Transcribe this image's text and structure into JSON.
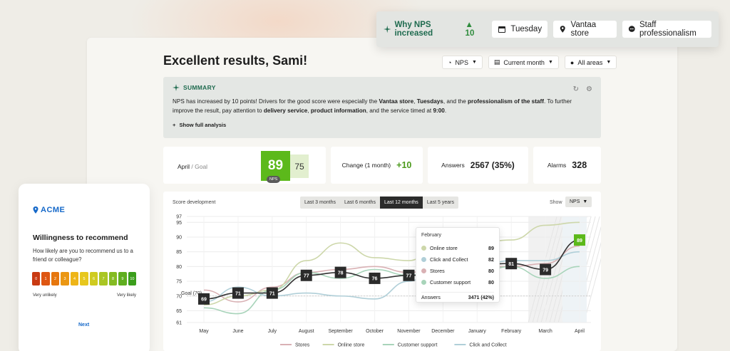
{
  "insight_bar": {
    "insight_label": "Why NPS increased",
    "insight_delta": "▲ 10",
    "chips": [
      "Tuesday",
      "Vantaa store",
      "Staff professionalism"
    ]
  },
  "header": {
    "title": "Excellent results, Sami!",
    "filters": {
      "metric": "NPS",
      "period": "Current month",
      "area": "All areas"
    }
  },
  "summary": {
    "heading": "SUMMARY",
    "text_html": "NPS has increased by 10 points! Drivers for the good score were especially the <b>Vantaa store</b>, <b>Tuesdays</b>, and the <b>professionalism of the staff</b>. To further improve the result, pay attention to <b>delivery service</b>, <b>product information</b>, and the service timed at <b>9:00</b>.",
    "show_more": "Show full analysis"
  },
  "cards": {
    "month_label": "April",
    "goal_label": "/ Goal",
    "score": "89",
    "goal": "75",
    "score_tag": "NPS",
    "change_label": "Change (1 month)",
    "change_value": "+10",
    "answers_label": "Answers",
    "answers_value": "2567 (35%)",
    "alarms_label": "Alarms",
    "alarms_value": "328"
  },
  "chart_panel": {
    "title": "Score development",
    "ranges": [
      "Last 3 months",
      "Last 6 months",
      "Last 12 months",
      "Last 5 years"
    ],
    "active_range": 2,
    "show_label": "Show",
    "show_value": "NPS"
  },
  "chart_data": {
    "type": "line",
    "x": [
      "May",
      "June",
      "July",
      "August",
      "September",
      "October",
      "November",
      "December",
      "January",
      "February",
      "March",
      "April"
    ],
    "yticks": [
      61,
      65,
      70,
      75,
      80,
      85,
      90,
      95,
      97
    ],
    "ylim": [
      61,
      97
    ],
    "goal_label": "Goal (70)",
    "goal": 70,
    "nps": [
      69,
      71,
      71,
      77,
      78,
      76,
      77,
      null,
      null,
      81,
      79,
      89
    ],
    "series": [
      {
        "name": "Stores",
        "color": "#d9b1b4",
        "values": [
          72,
          68,
          73,
          78,
          79,
          80,
          78,
          80,
          80,
          80,
          81,
          87
        ]
      },
      {
        "name": "Online store",
        "color": "#cdd7aa",
        "values": [
          67,
          70,
          72,
          82,
          88,
          83,
          82,
          89,
          88,
          89,
          94,
          95
        ]
      },
      {
        "name": "Customer support",
        "color": "#a8d4ba",
        "values": [
          66,
          64,
          72,
          78,
          76,
          79,
          77,
          80,
          78,
          80,
          76,
          80
        ]
      },
      {
        "name": "Click and Collect",
        "color": "#b0cfd8",
        "values": [
          68,
          73,
          70,
          71,
          70,
          69,
          75,
          82,
          80,
          82,
          82,
          85
        ]
      }
    ]
  },
  "tooltip": {
    "month": "February",
    "rows": [
      {
        "name": "Online store",
        "value": "89",
        "color": "#cdd7aa"
      },
      {
        "name": "Click and Collect",
        "value": "82",
        "color": "#b0cfd8"
      },
      {
        "name": "Stores",
        "value": "80",
        "color": "#d9b1b4"
      },
      {
        "name": "Customer support",
        "value": "80",
        "color": "#a8d4ba"
      }
    ],
    "answers_label": "Answers",
    "answers_value": "3471 (42%)"
  },
  "survey": {
    "logo": "ACME",
    "title": "Willingness to recommend",
    "question": "How likely are you to recommend us to a friend or colleague?",
    "scale": [
      "0",
      "1",
      "2",
      "3",
      "4",
      "5",
      "6",
      "7",
      "8",
      "9",
      "10"
    ],
    "scale_colors": [
      "#c93a12",
      "#de5612",
      "#e6770f",
      "#eb9713",
      "#eeb518",
      "#e7c71d",
      "#cfcb20",
      "#a9c623",
      "#84bb22",
      "#5fae1f",
      "#3b9e1c"
    ],
    "low_label": "Very unlikely",
    "high_label": "Very likely",
    "next": "Next"
  },
  "colors": {
    "accent_green": "#5cb91b",
    "brand_teal": "#1f6b4f",
    "dark": "#2b2b2b"
  }
}
